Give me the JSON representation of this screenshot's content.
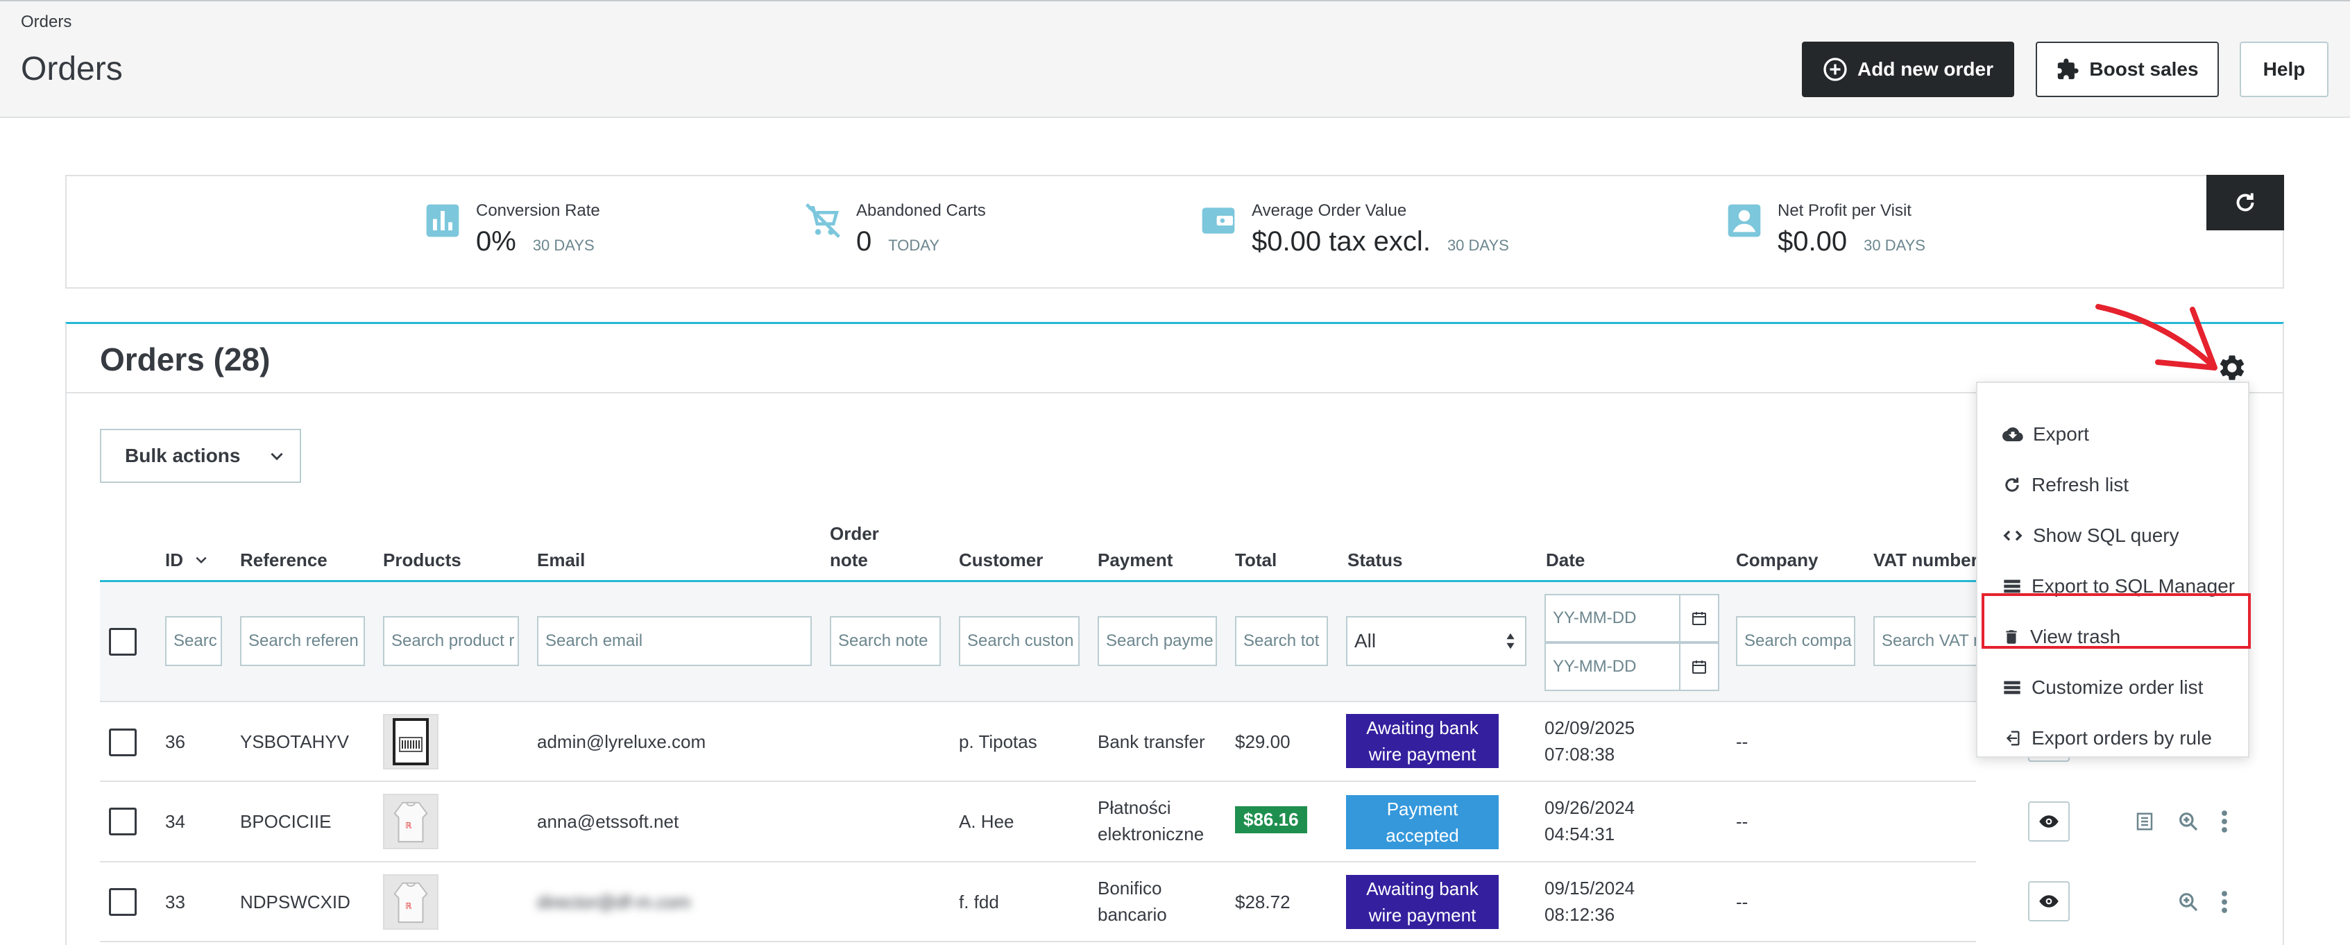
{
  "header": {
    "breadcrumb": "Orders",
    "title": "Orders",
    "add_new_order": "Add new order",
    "boost_sales": "Boost sales",
    "help": "Help"
  },
  "kpis": [
    {
      "label": "Conversion Rate",
      "value": "0%",
      "period": "30 DAYS",
      "icon": "bar-chart-icon"
    },
    {
      "label": "Abandoned Carts",
      "value": "0",
      "period": "TODAY",
      "icon": "remove-shopping-cart-icon"
    },
    {
      "label": "Average Order Value",
      "value": "$0.00 tax excl.",
      "period": "30 DAYS",
      "icon": "wallet-icon"
    },
    {
      "label": "Net Profit per Visit",
      "value": "$0.00",
      "period": "30 DAYS",
      "icon": "account-box-icon"
    }
  ],
  "orders": {
    "title": "Orders (28)",
    "bulk_actions": "Bulk actions",
    "columns": {
      "id": "ID",
      "reference": "Reference",
      "products": "Products",
      "email": "Email",
      "order_note_1": "Order",
      "order_note_2": "note",
      "customer": "Customer",
      "payment": "Payment",
      "total": "Total",
      "status": "Status",
      "date": "Date",
      "company": "Company",
      "vat": "VAT number"
    },
    "filters": {
      "id": "Searc",
      "reference": "Search referen",
      "products": "Search product r",
      "email": "Search email",
      "note": "Search note",
      "customer": "Search custon",
      "payment": "Search payme",
      "total": "Search tot",
      "status": "All",
      "date_from": "YY-MM-DD",
      "date_to": "YY-MM-DD",
      "company": "Search compa",
      "vat": "Search VAT n"
    },
    "rows": [
      {
        "id": "36",
        "reference": "YSBOTAHYV",
        "email": "admin@lyreluxe.com",
        "customer": "p. Tipotas",
        "payment_1": "Bank transfer",
        "payment_2": "",
        "total": "$29.00",
        "status_1": "Awaiting bank",
        "status_2": "wire payment",
        "status_color": "#34209e",
        "date_1": "02/09/2025",
        "date_2": "07:08:38",
        "company": "--"
      },
      {
        "id": "34",
        "reference": "BPOCICIIE",
        "email": "anna@etssoft.net",
        "customer": "A. Hee",
        "payment_1": "Płatności",
        "payment_2": "elektroniczne",
        "total": "$86.16",
        "status_1": "Payment",
        "status_2": "accepted",
        "status_color": "#3498db",
        "date_1": "09/26/2024",
        "date_2": "04:54:31",
        "company": "--"
      },
      {
        "id": "33",
        "reference": "NDPSWCXID",
        "email": "director@df-m.com",
        "customer": "f. fdd",
        "payment_1": "Bonifico",
        "payment_2": "bancario",
        "total": "$28.72",
        "status_1": "Awaiting bank",
        "status_2": "wire payment",
        "status_color": "#34209e",
        "date_1": "09/15/2024",
        "date_2": "08:12:36",
        "company": "--"
      }
    ]
  },
  "dropdown": {
    "items": [
      {
        "label": "Export",
        "icon": "cloud-download-icon"
      },
      {
        "label": "Refresh list",
        "icon": "refresh-icon"
      },
      {
        "label": "Show SQL query",
        "icon": "code-icon"
      },
      {
        "label": "Export to SQL Manager",
        "icon": "storage-icon"
      },
      {
        "label": "View trash",
        "icon": "trash-icon"
      },
      {
        "label": "Customize order list",
        "icon": "list-icon"
      },
      {
        "label": "Export orders by rule",
        "icon": "exit-to-app-icon"
      }
    ]
  }
}
